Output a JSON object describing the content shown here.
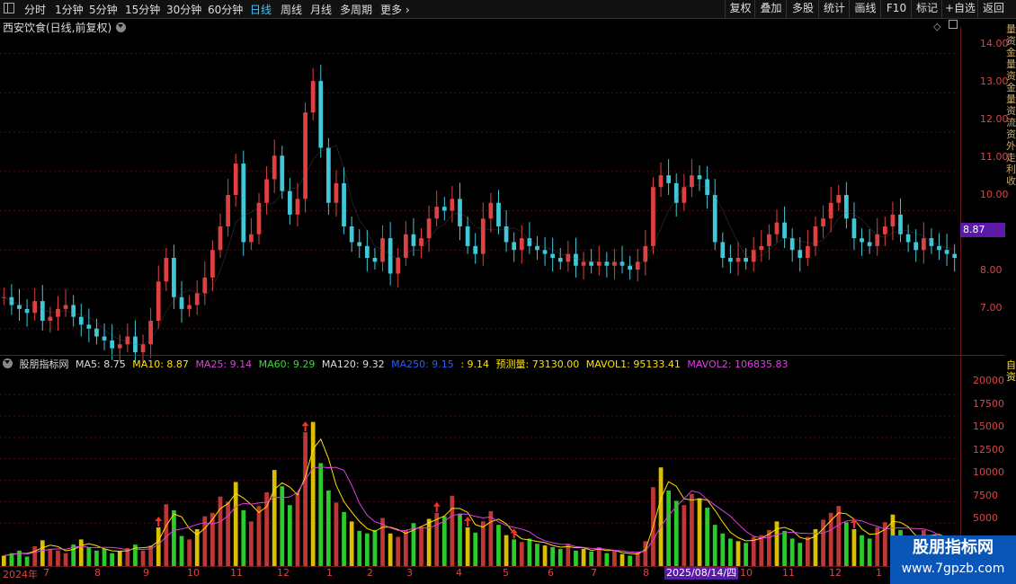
{
  "toolbar": {
    "periods": [
      "分时",
      "1分钟",
      "5分钟",
      "15分钟",
      "30分钟",
      "60分钟",
      "日线",
      "周线",
      "月线",
      "多周期",
      "更多"
    ],
    "active_period": "日线",
    "right_buttons": [
      "复权",
      "叠加",
      "多股",
      "统计",
      "画线",
      "F10",
      "标记",
      "+自选",
      "返回"
    ]
  },
  "stock": {
    "title": "西安饮食(日线,前复权)"
  },
  "price_axis": {
    "ticks": [
      "14.00",
      "13.00",
      "12.00",
      "11.00",
      "10.00",
      "9.00",
      "8.00",
      "7.00"
    ],
    "last_price": "8.87"
  },
  "volume_axis": {
    "ticks": [
      "20000",
      "17500",
      "15000",
      "12500",
      "10000",
      "7500",
      "5000"
    ]
  },
  "indicator_line": [
    {
      "text": "股朋指标网",
      "color": "#dddddd"
    },
    {
      "text": "MA5: 8.75",
      "color": "#dddddd"
    },
    {
      "text": "MA10: 8.87",
      "color": "#ffe000"
    },
    {
      "text": "MA25: 9.14",
      "color": "#e040e0"
    },
    {
      "text": "MA60: 9.29",
      "color": "#33dd33"
    },
    {
      "text": "MA120: 9.32",
      "color": "#dddddd"
    },
    {
      "text": "MA250: 9.15",
      "color": "#2b5bff"
    },
    {
      "text": ": 9.14",
      "color": "#ffe000"
    },
    {
      "text": "预测量: 73130.00",
      "color": "#ffe000"
    },
    {
      "text": "MAVOL1: 95133.41",
      "color": "#ffe000"
    },
    {
      "text": "MAVOL2: 106835.83",
      "color": "#e040e0"
    }
  ],
  "months": [
    "2024年",
    "7",
    "8",
    "9",
    "10",
    "11",
    "12",
    "1",
    "2",
    "3",
    "4",
    "5",
    "6",
    "7",
    "8",
    "9",
    "10",
    "11",
    "12",
    "1"
  ],
  "date_tag": "2025/08/14/四",
  "side_panel": {
    "text": "量资金量资金量资流资外走利收"
  },
  "side_panel_lower": {
    "text": "自资"
  },
  "watermark": {
    "title": "股朋指标网",
    "url": "www.7gpzb.com"
  },
  "colors": {
    "up": "#e04040",
    "down": "#40c8d8",
    "accent": "#3fc6ff",
    "grid": "#4a1010",
    "ma_yellow": "#ffe000",
    "ma_magenta": "#e040e0",
    "vol_green": "#33ee33"
  },
  "chart_data": {
    "type": "candlestick",
    "price_ylim": [
      6.4,
      14.4
    ],
    "volume_ylim": [
      0,
      22000
    ],
    "close_series": [
      7.8,
      7.6,
      7.5,
      7.4,
      7.7,
      7.2,
      7.3,
      7.5,
      7.6,
      7.3,
      7.1,
      7.0,
      6.8,
      6.7,
      6.5,
      6.6,
      6.8,
      6.4,
      6.6,
      7.2,
      8.2,
      8.8,
      7.8,
      7.5,
      7.6,
      7.9,
      8.3,
      9.0,
      9.6,
      10.4,
      11.2,
      9.2,
      9.4,
      10.2,
      10.8,
      11.4,
      10.5,
      9.9,
      10.3,
      12.5,
      13.3,
      11.6,
      10.2,
      10.7,
      9.6,
      9.2,
      9.1,
      8.8,
      8.7,
      9.3,
      8.4,
      8.8,
      9.4,
      9.1,
      9.3,
      9.8,
      10.1,
      10.0,
      10.3,
      9.6,
      9.1,
      8.9,
      9.8,
      10.2,
      9.6,
      9.2,
      9.0,
      9.3,
      9.1,
      9.0,
      8.9,
      8.8,
      8.7,
      8.9,
      8.6,
      8.7,
      8.6,
      8.7,
      8.6,
      8.7,
      8.6,
      8.5,
      8.7,
      9.1,
      10.6,
      10.9,
      10.7,
      10.2,
      10.6,
      10.9,
      10.8,
      10.4,
      9.2,
      8.8,
      8.7,
      8.8,
      8.7,
      9.0,
      9.1,
      9.4,
      9.7,
      9.3,
      9.0,
      8.8,
      9.1,
      9.6,
      9.8,
      10.2,
      10.4,
      9.8,
      9.3,
      9.2,
      9.1,
      9.4,
      9.6,
      9.9,
      9.4,
      9.2,
      9.0,
      9.3,
      9.1,
      9.0,
      8.9,
      8.8
    ],
    "volume_series": [
      1200,
      1500,
      1800,
      1100,
      2300,
      3000,
      2000,
      1800,
      1500,
      2500,
      3100,
      2200,
      1800,
      2000,
      1500,
      1700,
      2100,
      2500,
      1800,
      2400,
      4500,
      7200,
      6500,
      3500,
      3100,
      4300,
      5800,
      6200,
      8100,
      7500,
      9800,
      6500,
      5200,
      7000,
      8600,
      11200,
      9300,
      7100,
      8500,
      15600,
      16800,
      12000,
      8800,
      7400,
      6300,
      5200,
      4100,
      3800,
      4200,
      5600,
      3800,
      3400,
      4200,
      5000,
      4600,
      5500,
      6200,
      5800,
      8200,
      6100,
      4500,
      3900,
      5200,
      6400,
      4800,
      3600,
      3100,
      2800,
      3200,
      2600,
      2400,
      2200,
      2000,
      2600,
      1800,
      2000,
      1700,
      2200,
      1500,
      1800,
      1400,
      1200,
      1600,
      2900,
      9200,
      11500,
      8800,
      7600,
      7100,
      8400,
      7900,
      6800,
      4800,
      3800,
      3200,
      2900,
      2700,
      3400,
      3600,
      4200,
      5200,
      4100,
      3200,
      2700,
      3400,
      4300,
      5400,
      6200,
      7000,
      5100,
      4300,
      3600,
      3200,
      4500,
      5100,
      6000,
      4200,
      3500,
      2900,
      4200,
      3600,
      3300,
      3000,
      2800
    ]
  }
}
